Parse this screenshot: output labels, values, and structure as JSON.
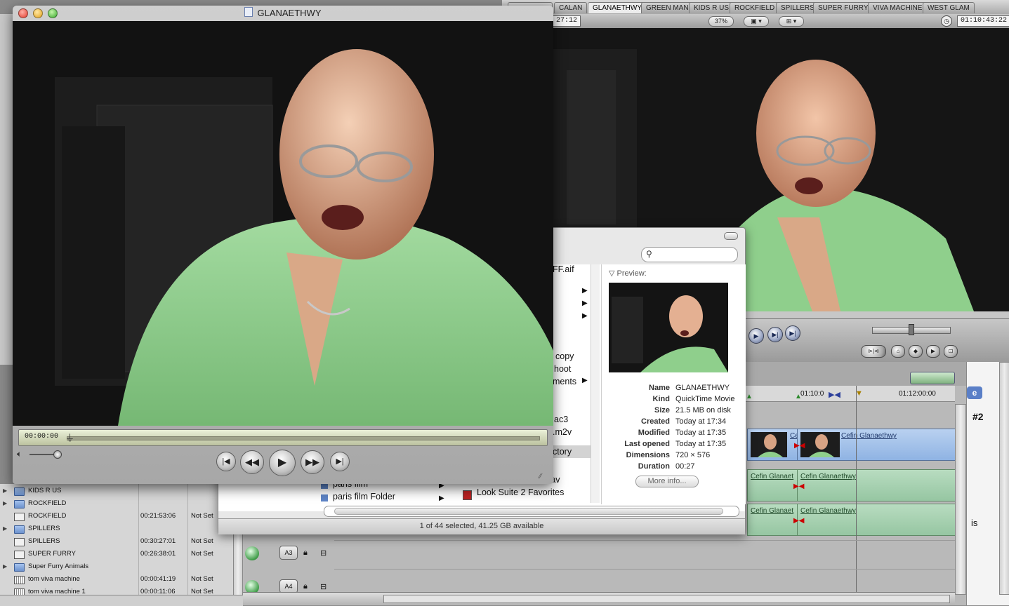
{
  "canvas": {
    "tabs": [
      "CALAN",
      "GLANAETHWY",
      "GREEN MAN",
      "KIDS R US",
      "ROCKFIELD",
      "SPILLERS",
      "SUPER FURRY",
      "VIVA MACHINE",
      "WEST GLAM"
    ],
    "active_tab": "GLANAETHWY",
    "timecode_left": "27:12",
    "zoom": "37%",
    "timecode_right": "01:10:43:22"
  },
  "quicktime": {
    "title": "GLANAETHWY",
    "current_time": "00:00:00"
  },
  "finder": {
    "search_placeholder": "",
    "column_items": [
      "FF.aif",
      "copy",
      "hoot",
      "ments",
      "ac3",
      ".m2v",
      "ctory",
      "paris film",
      "paris film Folder",
      "Look Suite 2 Favorites",
      "deo.wav"
    ],
    "preview_heading": "Preview:",
    "info": [
      {
        "key": "Name",
        "value": "GLANAETHWY"
      },
      {
        "key": "Kind",
        "value": "QuickTime Movie"
      },
      {
        "key": "Size",
        "value": "21.5 MB on disk"
      },
      {
        "key": "Created",
        "value": "Today at 17:34"
      },
      {
        "key": "Modified",
        "value": "Today at 17:35"
      },
      {
        "key": "Last opened",
        "value": "Today at 17:35"
      },
      {
        "key": "Dimensions",
        "value": "720 × 576"
      },
      {
        "key": "Duration",
        "value": "00:27"
      }
    ],
    "more_info": "More info...",
    "status": "1 of 44 selected, 41.25 GB available"
  },
  "browser": {
    "rows": [
      {
        "type": "folder",
        "expand": true,
        "name": "KIDS R US",
        "duration": "",
        "status": ""
      },
      {
        "type": "folder",
        "expand": true,
        "name": "ROCKFIELD",
        "duration": "",
        "status": ""
      },
      {
        "type": "seq",
        "expand": false,
        "name": "ROCKFIELD",
        "duration": "00:21:53:06",
        "status": "Not Set"
      },
      {
        "type": "folder",
        "expand": true,
        "name": "SPILLERS",
        "duration": "",
        "status": ""
      },
      {
        "type": "seq",
        "expand": false,
        "name": "SPILLERS",
        "duration": "00:30:27:01",
        "status": "Not Set"
      },
      {
        "type": "seq",
        "expand": false,
        "name": "SUPER FURRY",
        "duration": "00:26:38:01",
        "status": "Not Set"
      },
      {
        "type": "folder",
        "expand": true,
        "name": "Super Furry Animals",
        "duration": "",
        "status": ""
      },
      {
        "type": "clip",
        "expand": false,
        "name": "tom viva machine",
        "duration": "00:00:41:19",
        "status": "Not Set"
      },
      {
        "type": "clip",
        "expand": false,
        "name": "tom viva machine 1",
        "duration": "00:00:11:06",
        "status": "Not Set"
      }
    ]
  },
  "timeline": {
    "ruler": {
      "tc1": "01:10:0",
      "tc2": "01:12:00:00"
    },
    "video_clips": [
      "Ce",
      "Cefin Glanaethwy"
    ],
    "audio_clips": [
      "Cefin Glanaet",
      "Cefin Glanaethwy",
      "Cefin Glanaet",
      "Cefin Glanaethwy"
    ],
    "track_labels": [
      "A3",
      "A4"
    ]
  },
  "right_panel": {
    "text1": "#2",
    "text2": "is",
    "text3": "e"
  }
}
